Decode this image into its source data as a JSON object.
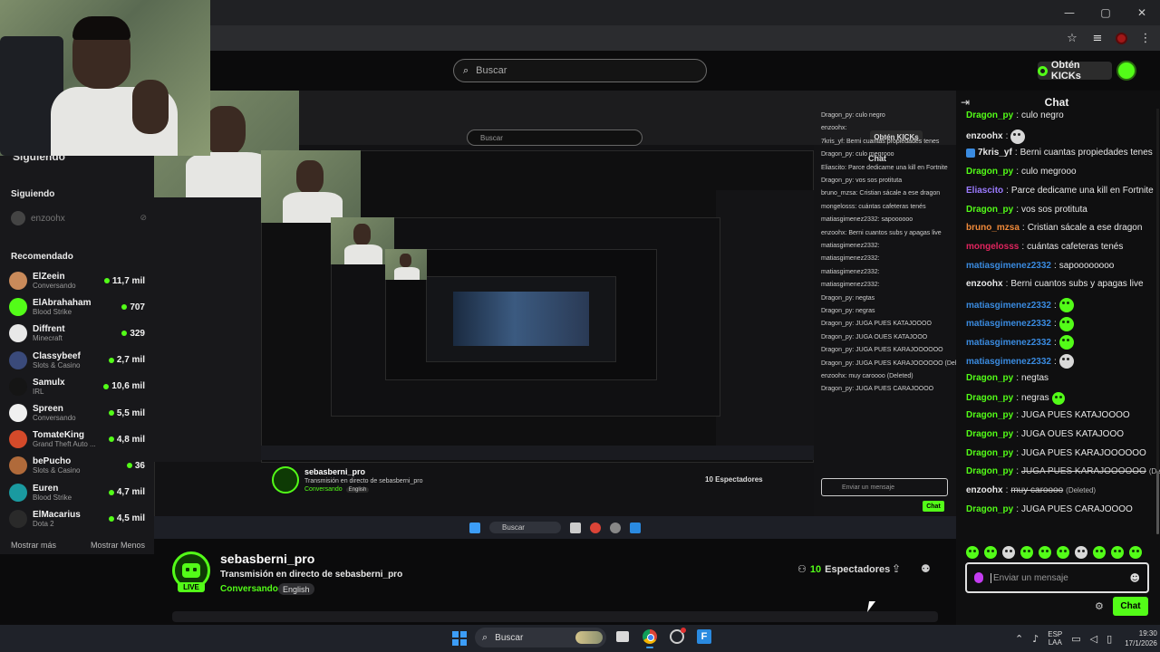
{
  "browser": {
    "window_controls": [
      "—",
      "▢",
      "✕"
    ],
    "toolbar_icons": [
      "star-icon",
      "media-icon",
      "profile-icon",
      "menu-icon"
    ]
  },
  "header": {
    "search_placeholder": "Buscar",
    "kicks_button": "Obtén KICKs"
  },
  "sidebar": {
    "heading": "Siguiendo",
    "following_title": "Siguiendo",
    "following": [
      {
        "name": "enzoohx"
      }
    ],
    "recommended_title": "Recomendado",
    "recommended": [
      {
        "name": "ElZeein",
        "category": "Conversando",
        "viewers": "11,7 mil",
        "color": "#c98a5a"
      },
      {
        "name": "ElAbrahaham",
        "category": "Blood Strike",
        "viewers": "707",
        "color": "#53fc18"
      },
      {
        "name": "Diffrent",
        "category": "Minecraft",
        "viewers": "329",
        "color": "#e8e8e8"
      },
      {
        "name": "Classybeef",
        "category": "Slots & Casino",
        "viewers": "2,7 mil",
        "color": "#3a4a7a"
      },
      {
        "name": "Samulx",
        "category": "IRL",
        "viewers": "10,6 mil",
        "color": "#151515"
      },
      {
        "name": "Spreen",
        "category": "Conversando",
        "viewers": "5,5 mil",
        "color": "#f0f0f0"
      },
      {
        "name": "TomateKing",
        "category": "Grand Theft Auto ...",
        "viewers": "4,8 mil",
        "color": "#d44a2a"
      },
      {
        "name": "bePucho",
        "category": "Slots & Casino",
        "viewers": "36",
        "color": "#b06a3a"
      },
      {
        "name": "Euren",
        "category": "Blood Strike",
        "viewers": "4,7 mil",
        "color": "#1a9aa0"
      },
      {
        "name": "ElMacarius",
        "category": "Dota 2",
        "viewers": "4,5 mil",
        "color": "#2a2a2a"
      }
    ],
    "show_more": "Mostrar más",
    "show_less": "Mostrar Menos"
  },
  "stream": {
    "streamer": "sebasberni_pro",
    "title": "Transmisión en directo de sebasberni_pro",
    "category": "Conversando",
    "tag": "English",
    "live_label": "LIVE",
    "viewers_count": "10",
    "viewers_label": "Espectadores"
  },
  "nested": {
    "search": "Buscar",
    "kicks": "Obtén KICKs",
    "chat_title": "Chat",
    "chat_lines": [
      "Dragon_py: culo negro",
      "enzoohx:",
      "7kris_yf: Berni cuantas propiedades tenes",
      "Dragon_py: culo megrooo",
      "Eliascito: Parce dedicame una kill en Fortnite",
      "Dragon_py: vos sos protituta",
      "bruno_mzsa: Cristian sácale a ese dragon",
      "mongelosss: cuántas cafeteras tenés",
      "matiasgimenez2332: sapoooooo",
      "enzoohx: Berni cuantos subs y apagas live",
      "matiasgimenez2332:",
      "matiasgimenez2332:",
      "matiasgimenez2332:",
      "matiasgimenez2332:",
      "Dragon_py: negtas",
      "Dragon_py: negras",
      "Dragon_py: JUGA PUES KATAJOOOO",
      "Dragon_py: JUGA OUES KATAJOOO",
      "Dragon_py: JUGA PUES KARAJOOOOOO",
      "Dragon_py: JUGA PUES KARAJOOOOOO (Deleted)",
      "enzoohx: muy caroooo (Deleted)",
      "Dragon_py: JUGA PUES CARAJOOOO"
    ],
    "streamer": "sebasberni_pro",
    "title": "Transmisión en directo de sebasberni_pro",
    "category": "Conversando",
    "tag": "English",
    "viewers": "10 Espectadores",
    "chat_placeholder": "Enviar un mensaje",
    "chat_send": "Chat",
    "taskbar_search": "Buscar"
  },
  "chat": {
    "title": "Chat",
    "messages": [
      {
        "user": "Dragon_py",
        "color": "#53fc18",
        "text": "culo negro"
      },
      {
        "user": "enzoohx",
        "color": "#e8e8e8",
        "text": "",
        "emote": true,
        "emote_style": "ghost"
      },
      {
        "user": "7kris_yf",
        "color": "#e8e8e8",
        "text": "Berni cuantas propiedades tenes",
        "badge": true
      },
      {
        "user": "Dragon_py",
        "color": "#53fc18",
        "text": "culo megrooo"
      },
      {
        "user": "Eliascito",
        "color": "#9b7bff",
        "text": "Parce dedicame una kill en Fortnite"
      },
      {
        "user": "Dragon_py",
        "color": "#53fc18",
        "text": "vos sos protituta"
      },
      {
        "user": "bruno_mzsa",
        "color": "#f08a3a",
        "text": "Cristian sácale a ese dragon"
      },
      {
        "user": "mongelosss",
        "color": "#e0245e",
        "text": "cuántas cafeteras tenés"
      },
      {
        "user": "matiasgimenez2332",
        "color": "#3a8be0",
        "text": "sapoooooooo"
      },
      {
        "user": "enzoohx",
        "color": "#e8e8e8",
        "text": "Berni cuantos subs y apagas live"
      },
      {
        "user": "matiasgimenez2332",
        "color": "#3a8be0",
        "text": "",
        "emote": true
      },
      {
        "user": "matiasgimenez2332",
        "color": "#3a8be0",
        "text": "",
        "emote": true
      },
      {
        "user": "matiasgimenez2332",
        "color": "#3a8be0",
        "text": "",
        "emote": true
      },
      {
        "user": "matiasgimenez2332",
        "color": "#3a8be0",
        "text": "",
        "emote": true,
        "emote_style": "ghost"
      },
      {
        "user": "Dragon_py",
        "color": "#53fc18",
        "text": "negtas"
      },
      {
        "user": "Dragon_py",
        "color": "#53fc18",
        "text": "negras",
        "emote_after": true
      },
      {
        "user": "Dragon_py",
        "color": "#53fc18",
        "text": "JUGA PUES KATAJOOOO"
      },
      {
        "user": "Dragon_py",
        "color": "#53fc18",
        "text": "JUGA OUES KATAJOOO"
      },
      {
        "user": "Dragon_py",
        "color": "#53fc18",
        "text": "JUGA PUES KARAJOOOOOO"
      },
      {
        "user": "Dragon_py",
        "color": "#53fc18",
        "text": "JUGA PUES KARAJOOOOOO",
        "deleted": true
      },
      {
        "user": "enzoohx",
        "color": "#e8e8e8",
        "text": "muy caroooo",
        "deleted": true
      },
      {
        "user": "Dragon_py",
        "color": "#53fc18",
        "text": "JUGA PUES CARAJOOOO"
      }
    ],
    "deleted_label": "(Deleted)",
    "input_placeholder": "Enviar un mensaje",
    "send_label": "Chat",
    "emote_count": 10
  },
  "taskbar": {
    "search": "Buscar",
    "lang_top": "ESP",
    "lang_bottom": "LAA",
    "time": "19:30",
    "date": "17/1/2026"
  }
}
